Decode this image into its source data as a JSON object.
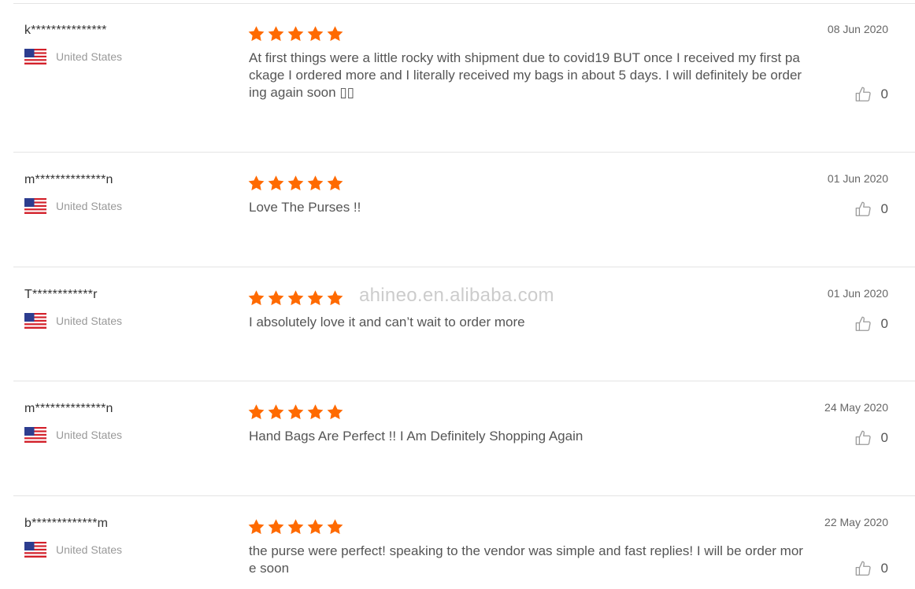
{
  "watermark": "ahineo.en.alibaba.com",
  "colors": {
    "star": "#ff6a00",
    "divider": "#e4e4e4",
    "text": "#555555",
    "muted": "#999999"
  },
  "icons": {
    "star": "star-icon",
    "flag": "us-flag-icon",
    "like": "thumbs-up-icon"
  },
  "reviews": [
    {
      "username": "k***************",
      "country": "United States",
      "rating": 5,
      "text": "At first things were a little rocky with shipment due to covid19 BUT once I received my first package I ordered more and I literally received my bags in about 5 days. I will definitely be ordering again soon ▯▯",
      "date": "08 Jun 2020",
      "likes": "0"
    },
    {
      "username": "m**************n",
      "country": "United States",
      "rating": 5,
      "text": "Love The Purses !!",
      "date": "01 Jun 2020",
      "likes": "0"
    },
    {
      "username": "T************r",
      "country": "United States",
      "rating": 5,
      "text": "I absolutely love it and can’t wait to order more",
      "date": "01 Jun 2020",
      "likes": "0"
    },
    {
      "username": "m**************n",
      "country": "United States",
      "rating": 5,
      "text": "Hand Bags Are Perfect !! I Am Definitely Shopping Again",
      "date": "24 May 2020",
      "likes": "0"
    },
    {
      "username": "b*************m",
      "country": "United States",
      "rating": 5,
      "text": "the purse were perfect! speaking to the vendor was simple and fast replies! I will be order more soon",
      "date": "22 May 2020",
      "likes": "0"
    }
  ]
}
